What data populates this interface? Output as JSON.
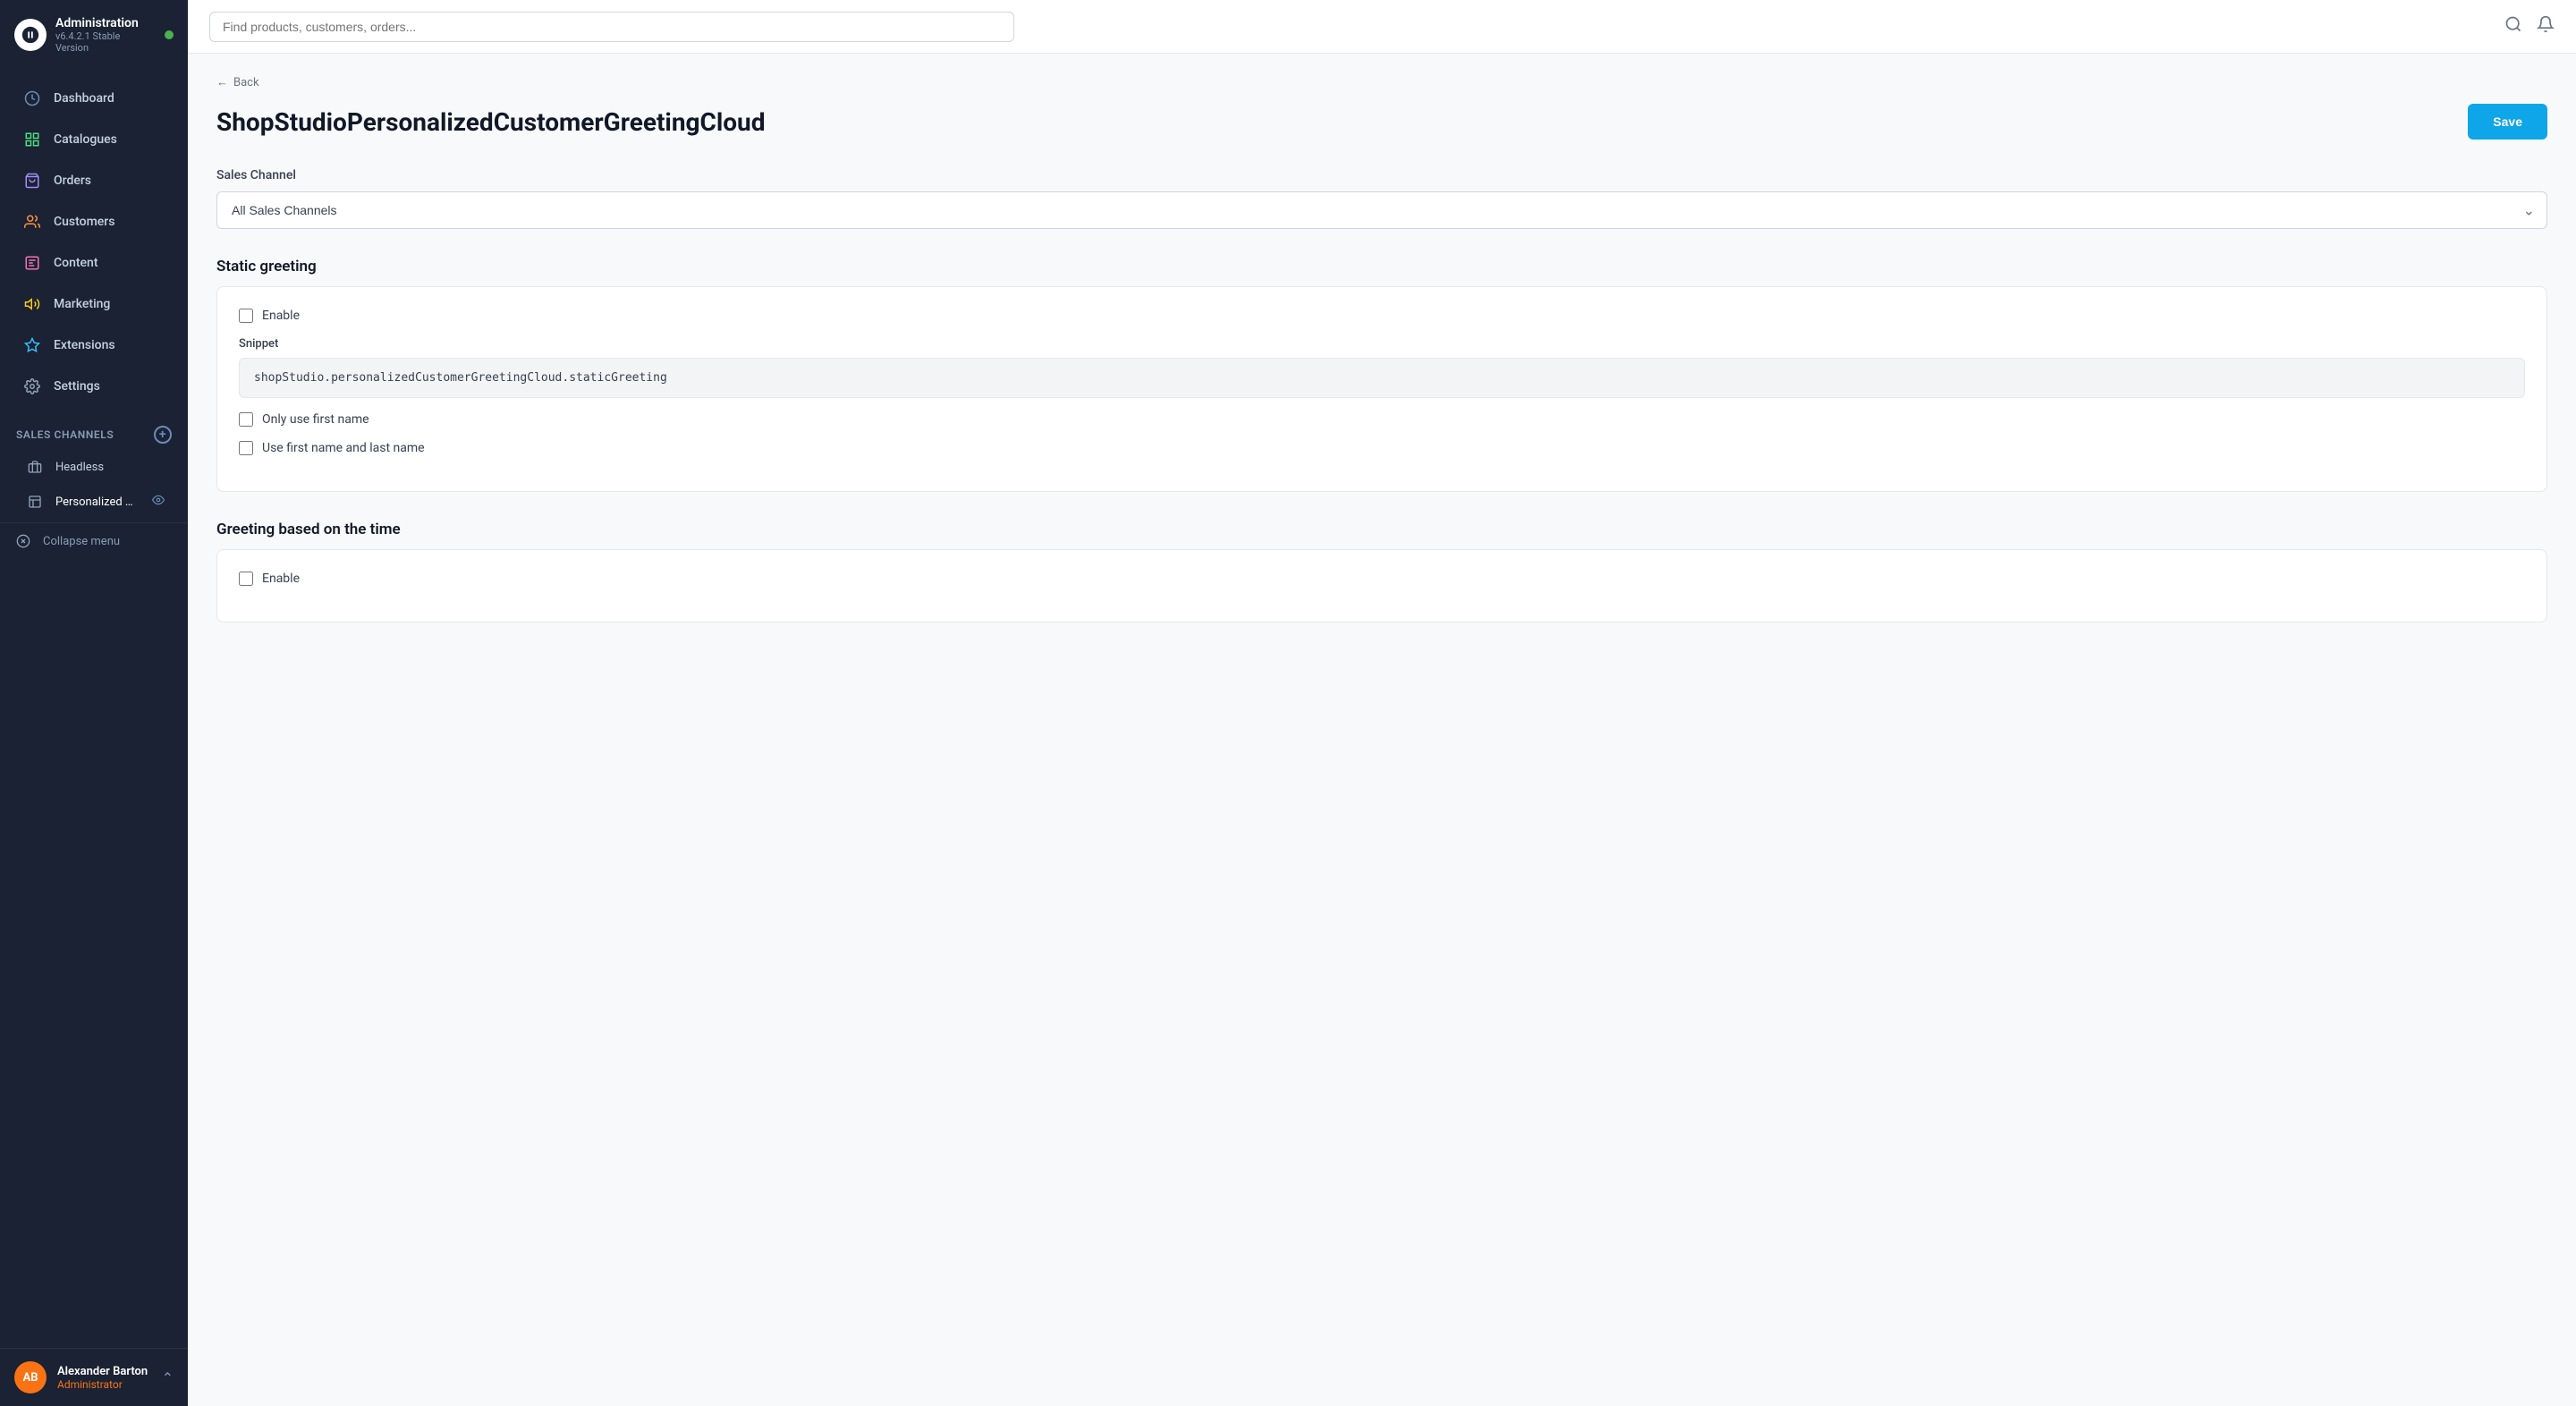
{
  "sidebar": {
    "brand": {
      "title": "Administration",
      "version": "v6.4.2.1 Stable Version"
    },
    "nav_items": [
      {
        "id": "dashboard",
        "label": "Dashboard",
        "icon": "dashboard"
      },
      {
        "id": "catalogues",
        "label": "Catalogues",
        "icon": "catalogues"
      },
      {
        "id": "orders",
        "label": "Orders",
        "icon": "orders"
      },
      {
        "id": "customers",
        "label": "Customers",
        "icon": "customers"
      },
      {
        "id": "content",
        "label": "Content",
        "icon": "content"
      },
      {
        "id": "marketing",
        "label": "Marketing",
        "icon": "marketing"
      },
      {
        "id": "extensions",
        "label": "Extensions",
        "icon": "extensions"
      },
      {
        "id": "settings",
        "label": "Settings",
        "icon": "settings"
      }
    ],
    "sales_channels": {
      "label": "Sales Channels",
      "items": [
        {
          "id": "headless",
          "label": "Headless",
          "icon": "bag"
        },
        {
          "id": "personalized",
          "label": "Personalized customer gre...",
          "icon": "grid",
          "active": true
        }
      ]
    },
    "collapse_label": "Collapse menu",
    "user": {
      "initials": "AB",
      "name": "Alexander Barton",
      "role": "Administrator"
    }
  },
  "topbar": {
    "search_placeholder": "Find products, customers, orders..."
  },
  "page": {
    "back_label": "Back",
    "title": "ShopStudioPersonalizedCustomerGreetingCloud",
    "save_label": "Save"
  },
  "form": {
    "sales_channel": {
      "label": "Sales Channel",
      "value": "All Sales Channels",
      "options": [
        "All Sales Channels"
      ]
    },
    "static_greeting": {
      "heading": "Static greeting",
      "enable_label": "Enable",
      "snippet_label": "Snippet",
      "snippet_value": "shopStudio.personalizedCustomerGreetingCloud.staticGreeting",
      "only_first_name_label": "Only use first name",
      "first_last_name_label": "Use first name and last name"
    },
    "time_greeting": {
      "heading": "Greeting based on the time",
      "enable_label": "Enable"
    }
  }
}
